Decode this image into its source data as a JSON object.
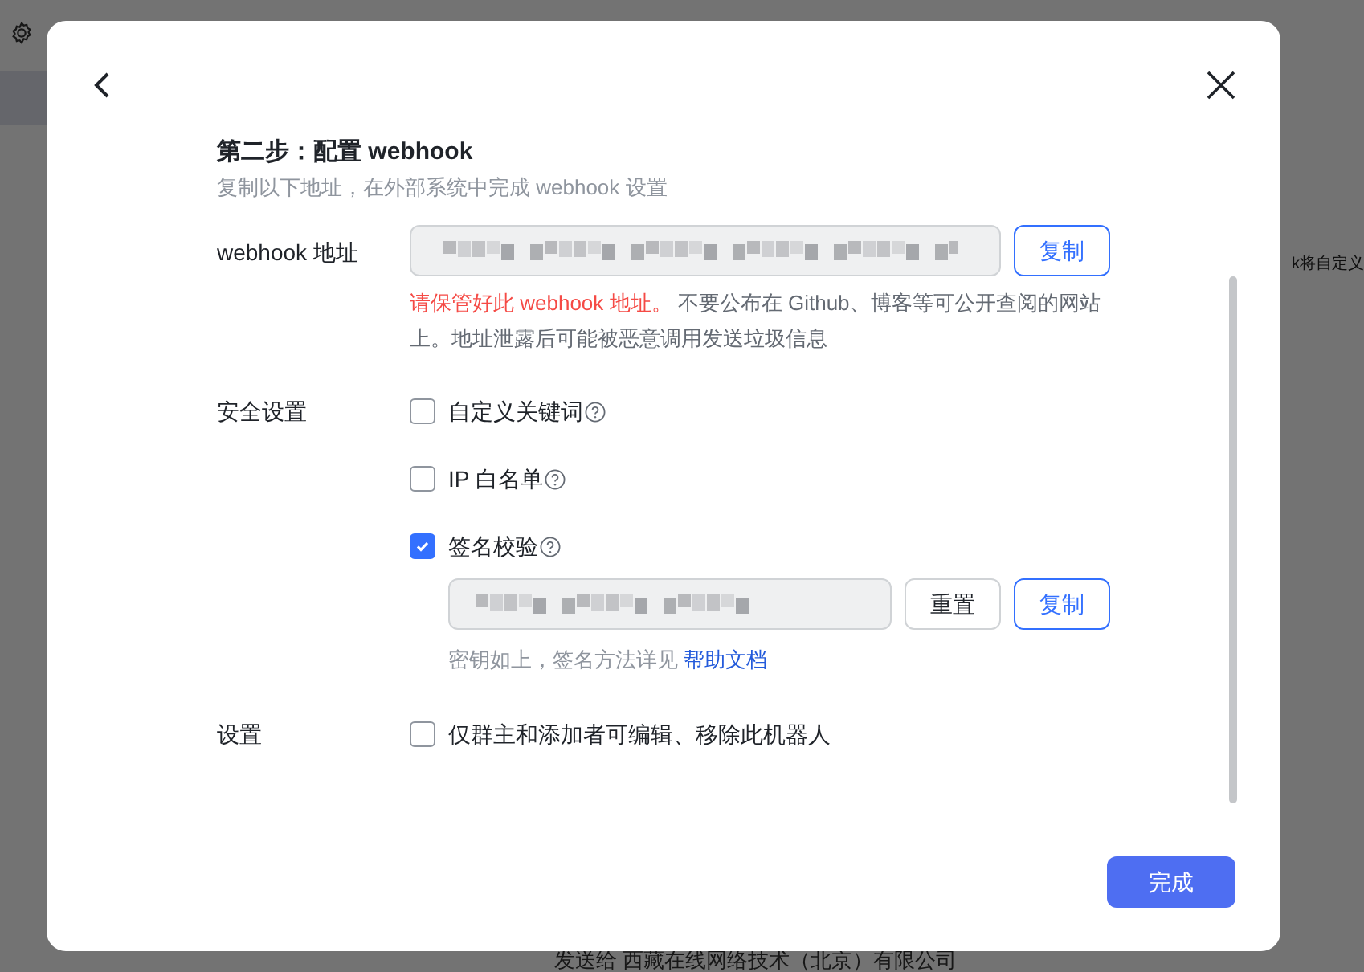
{
  "background": {
    "side_text": "k将自定义",
    "bottom_text": "发送给 西藏在线网络技术（北京）有限公司"
  },
  "dialog": {
    "step_title": "第二步：配置 webhook",
    "subtitle": "复制以下地址，在外部系统中完成 webhook 设置",
    "webhook": {
      "label": "webhook 地址",
      "copy_button": "复制",
      "warning_red": "请保管好此 webhook 地址。",
      "warning_rest": " 不要公布在 Github、博客等可公开查阅的网站上。地址泄露后可能被恶意调用发送垃圾信息"
    },
    "security": {
      "label": "安全设置",
      "options": [
        {
          "label": "自定义关键词",
          "checked": false
        },
        {
          "label": "IP 白名单",
          "checked": false
        },
        {
          "label": "签名校验",
          "checked": true
        }
      ],
      "secret": {
        "reset_button": "重置",
        "copy_button": "复制",
        "hint": "密钥如上，签名方法详见 ",
        "help_link": "帮助文档"
      }
    },
    "settings": {
      "label": "设置",
      "option": {
        "label": "仅群主和添加者可编辑、移除此机器人",
        "checked": false
      }
    },
    "done_button": "完成"
  }
}
